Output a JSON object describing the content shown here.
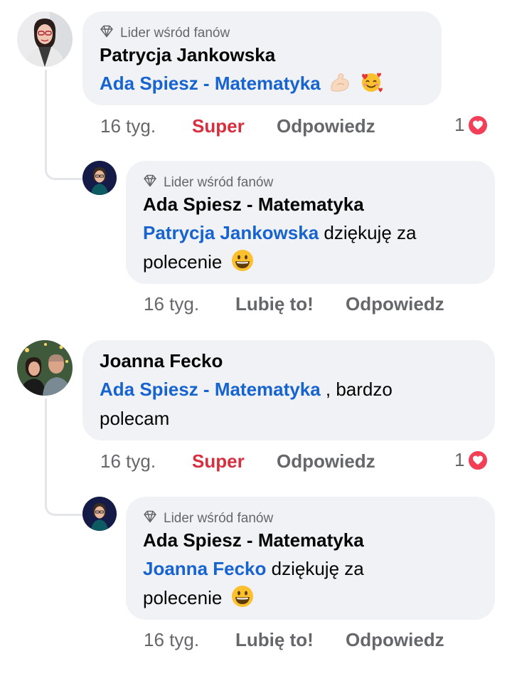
{
  "comments": [
    {
      "badge": "Lider wśród fanów",
      "author": "Patrycja Jankowska",
      "mention": "Ada Spiesz - Matematyka",
      "text": "",
      "time": "16 tyg.",
      "reaction": "Super",
      "reply": "Odpowiedz",
      "reaction_count": "1",
      "reply_item": {
        "badge": "Lider wśród fanów",
        "author": "Ada Spiesz - Matematyka",
        "mention": "Patrycja Jankowska",
        "text_line1": "dziękuję za",
        "text_line2": "polecenie",
        "time": "16 tyg.",
        "like": "Lubię to!",
        "reply": "Odpowiedz"
      }
    },
    {
      "author": "Joanna Fecko",
      "mention": "Ada Spiesz - Matematyka",
      "text_line1": " , bardzo",
      "text_line2": "polecam",
      "time": "16 tyg.",
      "reaction": "Super",
      "reply": "Odpowiedz",
      "reaction_count": "1",
      "reply_item": {
        "badge": "Lider wśród fanów",
        "author": "Ada Spiesz - Matematyka",
        "mention": "Joanna Fecko",
        "text_line1": "dziękuję za",
        "text_line2": "polecenie",
        "time": "16 tyg.",
        "like": "Lubię to!",
        "reply": "Odpowiedz"
      }
    }
  ],
  "icons": {
    "badge": "diamond-icon",
    "reaction": "heart-icon",
    "emoji_strong": "flexed-biceps-emoji",
    "emoji_love": "smiling-face-with-hearts-emoji",
    "emoji_grin": "grinning-face-emoji"
  },
  "colors": {
    "mention": "#1763cf",
    "super": "#d63040",
    "bubble": "#f0f2f5",
    "muted": "#65676b",
    "heart": "#f33e58"
  }
}
